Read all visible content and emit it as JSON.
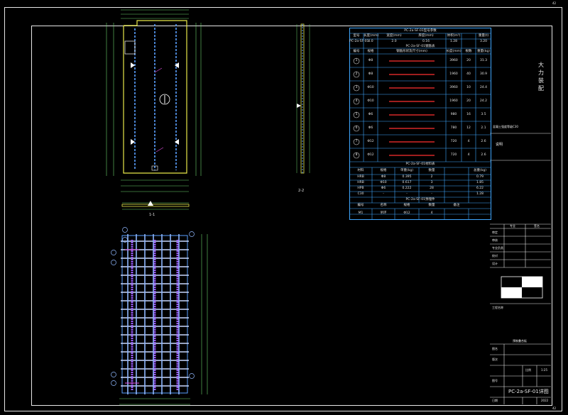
{
  "sheet": {
    "corner_number_top": "42",
    "corner_number_bottom": "42"
  },
  "drawing": {
    "section_label_1": "1-1",
    "section_label_2": "2-2",
    "axis_labels": [
      "A",
      "B",
      "C",
      "D"
    ]
  },
  "table1": {
    "title": "PC-2a-SF-01型号参数",
    "header": [
      "型号",
      "长度(mm)",
      "宽度(mm)",
      "厚度(mm)",
      "体积(m³)",
      "重量(t)"
    ],
    "row": [
      "PC-2a-SF-01",
      "4.0",
      "2.0",
      "0.16",
      "1.28",
      "3.20"
    ]
  },
  "table2": {
    "title": "PC-2a-SF-01钢筋表",
    "header": [
      "编号",
      "规格",
      "钢筋形状及尺寸(mm)",
      "长度(mm)",
      "根数",
      "重量(kg)"
    ],
    "rows": [
      {
        "no": "1",
        "spec": "Φ8",
        "len": "3960",
        "count": "20",
        "wt": "31.3"
      },
      {
        "no": "2",
        "spec": "Φ8",
        "len": "1960",
        "count": "40",
        "wt": "30.9"
      },
      {
        "no": "3",
        "spec": "Φ10",
        "len": "3960",
        "count": "10",
        "wt": "24.4"
      },
      {
        "no": "4",
        "spec": "Φ10",
        "len": "1960",
        "count": "20",
        "wt": "24.2"
      },
      {
        "no": "5",
        "spec": "Φ6",
        "len": "980",
        "count": "16",
        "wt": "3.5"
      },
      {
        "no": "6",
        "spec": "Φ6",
        "len": "780",
        "count": "12",
        "wt": "2.1"
      },
      {
        "no": "7",
        "spec": "Φ12",
        "len": "720",
        "count": "4",
        "wt": "2.6"
      },
      {
        "no": "8",
        "spec": "Φ12",
        "len": "720",
        "count": "4",
        "wt": "2.6"
      }
    ]
  },
  "table3": {
    "title": "PC-2a-SF-01材料表",
    "header": [
      "材料",
      "规格",
      "单重(kg)",
      "数量",
      "总重(kg)"
    ],
    "rows": [
      [
        "HRB",
        "Φ8",
        "0.395",
        "2",
        "0.79"
      ],
      [
        "HRB",
        "Φ10",
        "0.617",
        "3",
        "1.85"
      ],
      [
        "HPB",
        "Φ6",
        "0.222",
        "28",
        "6.22"
      ],
      [
        "C30",
        "-",
        "-",
        "-",
        "1.28"
      ]
    ],
    "subtitle": "PC-2a-SF-01预埋件",
    "subheader": [
      "编号",
      "名称",
      "规格",
      "数量",
      "备注"
    ],
    "subrow": [
      "M1",
      "吊环",
      "Φ12",
      "4",
      ""
    ]
  },
  "title_block": {
    "company_text": "大力装配",
    "note_label": "说明",
    "notes_line": "混凝土强度等级C30",
    "rows_left": [
      "审定",
      "审核",
      "专业负责",
      "校对",
      "设计"
    ],
    "header_cols": [
      "专业",
      "签名"
    ],
    "project_label": "工程名称",
    "project_value": "预制叠合板",
    "drawing_name_label": "图名",
    "scale_label": "比例",
    "scale_value": "1:25",
    "sheet_label": "图号",
    "drawing_no": "PC-2a-SF-01详图",
    "date_label": "日期",
    "date_value": "2022",
    "version_label": "版次"
  }
}
